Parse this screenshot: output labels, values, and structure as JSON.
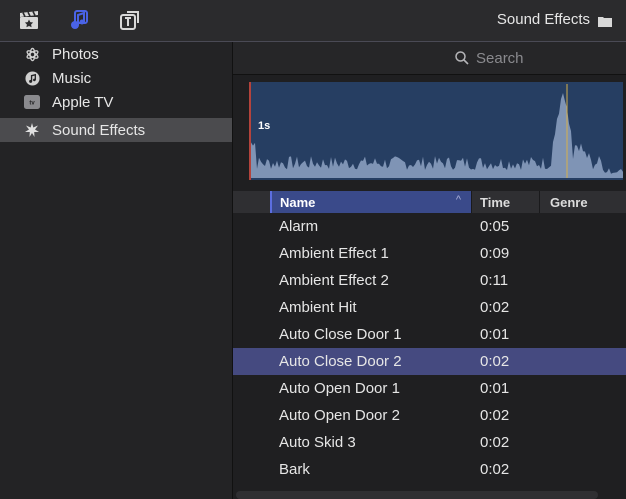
{
  "toolbar": {
    "icons": [
      "clapperboard-icon",
      "music-photos-icon",
      "titles-icon"
    ],
    "title": "Sound Effects",
    "title_icon": "folder-icon"
  },
  "sidebar": {
    "items": [
      {
        "label": "Photos",
        "icon": "photos-icon",
        "selected": false
      },
      {
        "label": "Music",
        "icon": "music-icon",
        "selected": false
      },
      {
        "label": "Apple TV",
        "icon": "appletv-icon",
        "selected": false
      },
      {
        "label": "Sound Effects",
        "icon": "sound-effects-icon",
        "selected": true
      }
    ]
  },
  "search": {
    "placeholder": "Search"
  },
  "waveform": {
    "time_label": "1s"
  },
  "table": {
    "columns": [
      "Name",
      "Time",
      "Genre"
    ],
    "sort_column": "Name",
    "rows": [
      {
        "name": "Alarm",
        "time": "0:05",
        "genre": "",
        "selected": false
      },
      {
        "name": "Ambient Effect 1",
        "time": "0:09",
        "genre": "",
        "selected": false
      },
      {
        "name": "Ambient Effect 2",
        "time": "0:11",
        "genre": "",
        "selected": false
      },
      {
        "name": "Ambient Hit",
        "time": "0:02",
        "genre": "",
        "selected": false
      },
      {
        "name": "Auto Close Door 1",
        "time": "0:01",
        "genre": "",
        "selected": false
      },
      {
        "name": "Auto Close Door 2",
        "time": "0:02",
        "genre": "",
        "selected": true
      },
      {
        "name": "Auto Open Door 1",
        "time": "0:01",
        "genre": "",
        "selected": false
      },
      {
        "name": "Auto Open Door 2",
        "time": "0:02",
        "genre": "",
        "selected": false
      },
      {
        "name": "Auto Skid 3",
        "time": "0:02",
        "genre": "",
        "selected": false
      },
      {
        "name": "Bark",
        "time": "0:02",
        "genre": "",
        "selected": false
      }
    ]
  },
  "colors": {
    "selection": "#454a80",
    "header_sort": "#3a4a8a",
    "waveform_bg": "#263e62",
    "waveform_fill": "#8fa3c4",
    "playhead": "#b3433c"
  }
}
